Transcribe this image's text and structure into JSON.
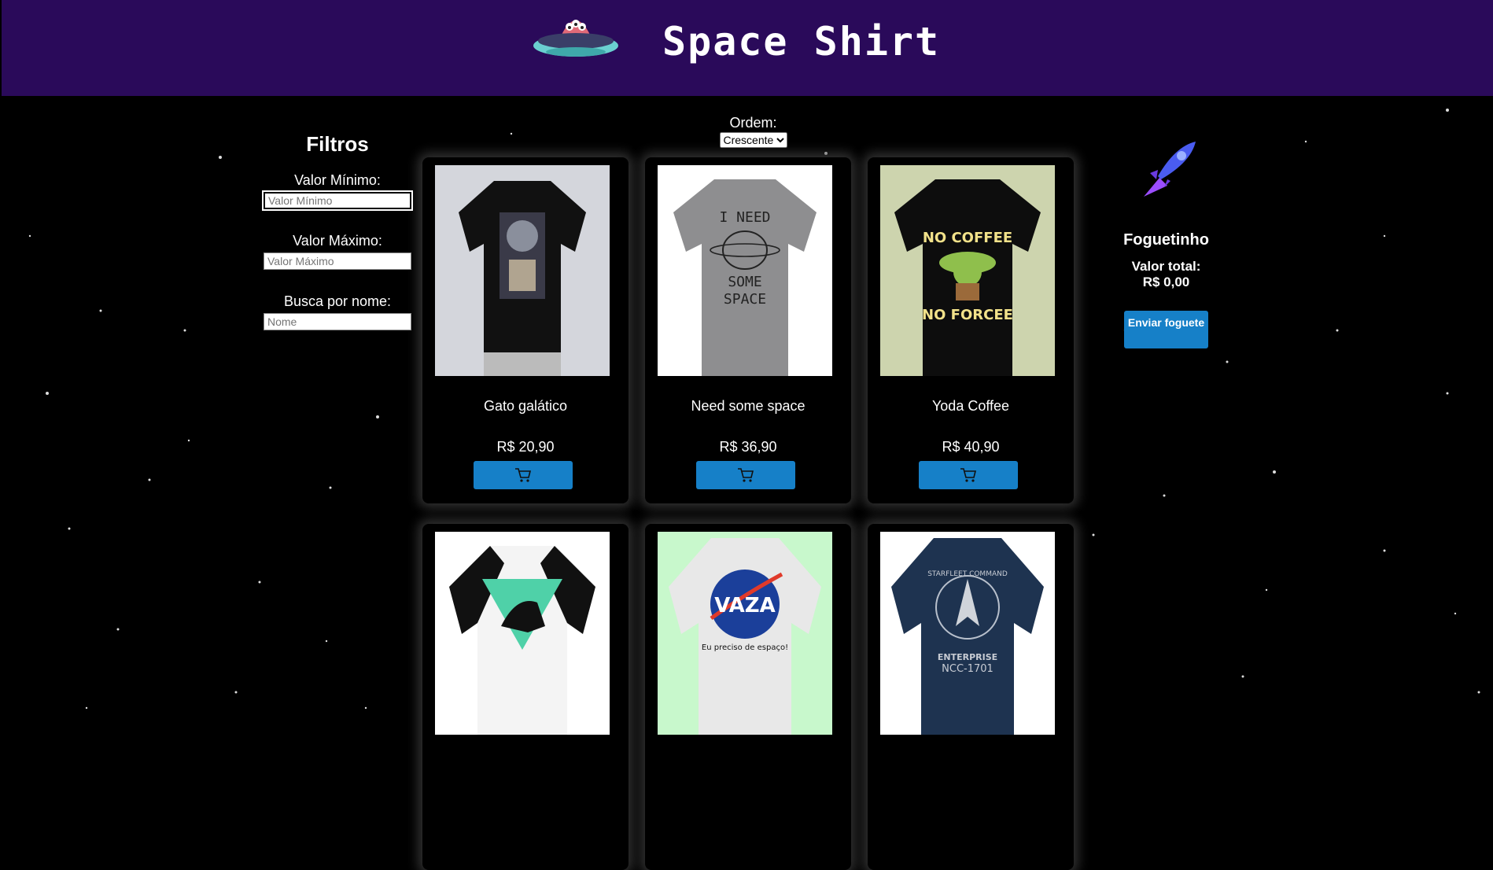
{
  "header": {
    "title": "Space Shirt",
    "logo_icon": "ufo-icon"
  },
  "filters": {
    "title": "Filtros",
    "min_label": "Valor Mínimo:",
    "min_placeholder": "Valor Mínimo",
    "max_label": "Valor Máximo:",
    "max_placeholder": "Valor Máximo",
    "name_label": "Busca por nome:",
    "name_placeholder": "Nome"
  },
  "order": {
    "label": "Ordem:",
    "selected": "Crescente"
  },
  "products": [
    {
      "name": "Gato galático",
      "price": "R$ 20,90",
      "image": "black-astronaut-cat-shirt"
    },
    {
      "name": "Need some space",
      "price": "R$ 36,90",
      "image": "grey-need-some-space-shirt"
    },
    {
      "name": "Yoda Coffee",
      "price": "R$ 40,90",
      "image": "black-no-coffee-no-forcee-shirt"
    },
    {
      "name": "",
      "price": "",
      "image": "raglan-astronaut-unicorn-shirt"
    },
    {
      "name": "",
      "price": "",
      "image": "white-vaza-shirt",
      "print_text": "VAZA",
      "print_subtext": "Eu preciso de espaço!"
    },
    {
      "name": "",
      "price": "",
      "image": "navy-starfleet-shirt",
      "print_text": "STARFLEET COMMAND",
      "print_subtext": "ENTERPRISE",
      "print_code": "NCC-1701"
    }
  ],
  "cart": {
    "title": "Foguetinho",
    "icon": "rocket-icon",
    "total_label": "Valor total:",
    "total_value": "R$ 0,00",
    "send_label": "Enviar foguete"
  },
  "colors": {
    "header": "#2a0a5a",
    "button": "#1680c8",
    "background": "#000000"
  }
}
